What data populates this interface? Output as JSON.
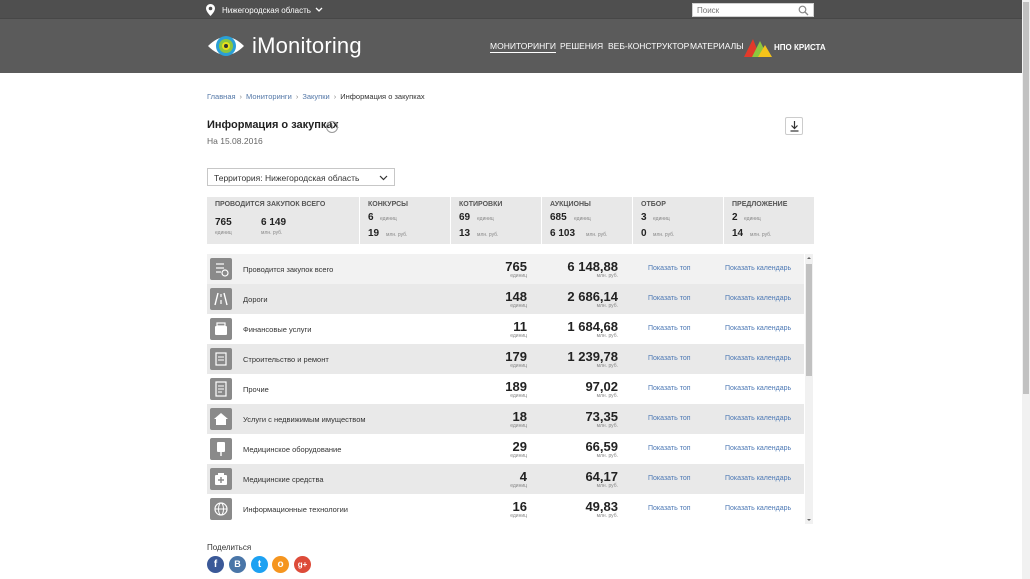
{
  "header": {
    "region": "Нижегородская область",
    "search_placeholder": "Поиск",
    "brand": "iMonitoring",
    "nav": [
      {
        "label": "МОНИТОРИНГИ",
        "active": true
      },
      {
        "label": "РЕШЕНИЯ",
        "active": false
      },
      {
        "label": "ВЕБ-КОНСТРУКТОР",
        "active": false
      },
      {
        "label": "МАТЕРИАЛЫ",
        "active": false
      }
    ],
    "partner": "НПО КРИСТА"
  },
  "breadcrumb": [
    "Главная",
    "Мониторинги",
    "Закупки",
    "Информация о закупках"
  ],
  "page": {
    "title": "Информация о закупках",
    "info": "i",
    "date": "На 15.08.2016"
  },
  "territory": "Территория: Нижегородская область",
  "summary": {
    "total": {
      "title": "ПРОВОДИТСЯ ЗАКУПОК ВСЕГО",
      "units": "765",
      "units_label": "единиц",
      "money": "6 149",
      "money_label": "млн. руб."
    },
    "cols": [
      {
        "title": "КОНКУРСЫ",
        "units": "6",
        "money": "19"
      },
      {
        "title": "КОТИРОВКИ",
        "units": "69",
        "money": "13"
      },
      {
        "title": "АУКЦИОНЫ",
        "units": "685",
        "money": "6 103"
      },
      {
        "title": "ОТБОР",
        "units": "3",
        "money": "0"
      },
      {
        "title": "ПРЕДЛОЖЕНИЕ",
        "units": "2",
        "money": "14"
      }
    ],
    "units_label": "единиц",
    "money_label": "млн. руб."
  },
  "table": {
    "units_label": "единиц",
    "money_label": "млн. руб.",
    "top_link": "Показать топ",
    "cal_link": "Показать календарь",
    "rows": [
      {
        "label": "Проводится закупок всего",
        "units": "765",
        "money": "6 148,88",
        "icon": "list-check-icon"
      },
      {
        "label": "Дороги",
        "units": "148",
        "money": "2 686,14",
        "icon": "road-icon"
      },
      {
        "label": "Финансовые услуги",
        "units": "11",
        "money": "1 684,68",
        "icon": "wallet-icon"
      },
      {
        "label": "Строительство и ремонт",
        "units": "179",
        "money": "1 239,78",
        "icon": "construction-icon"
      },
      {
        "label": "Прочие",
        "units": "189",
        "money": "97,02",
        "icon": "document-icon"
      },
      {
        "label": "Услуги с недвижимым имуществом",
        "units": "18",
        "money": "73,35",
        "icon": "building-icon"
      },
      {
        "label": "Медицинское оборудование",
        "units": "29",
        "money": "66,59",
        "icon": "medical-device-icon"
      },
      {
        "label": "Медицинские средства",
        "units": "4",
        "money": "64,17",
        "icon": "first-aid-icon"
      },
      {
        "label": "Информационные технологии",
        "units": "16",
        "money": "49,83",
        "icon": "globe-icon"
      }
    ]
  },
  "share": {
    "label": "Поделиться",
    "networks": [
      {
        "name": "facebook",
        "glyph": "f",
        "color": "#3b5998"
      },
      {
        "name": "vkontakte",
        "glyph": "В",
        "color": "#4a76a8"
      },
      {
        "name": "twitter",
        "glyph": "t",
        "color": "#1da1f2"
      },
      {
        "name": "odnoklassniki",
        "glyph": "о",
        "color": "#f5951f"
      },
      {
        "name": "google-plus",
        "glyph": "g+",
        "color": "#dd4b39"
      }
    ]
  }
}
